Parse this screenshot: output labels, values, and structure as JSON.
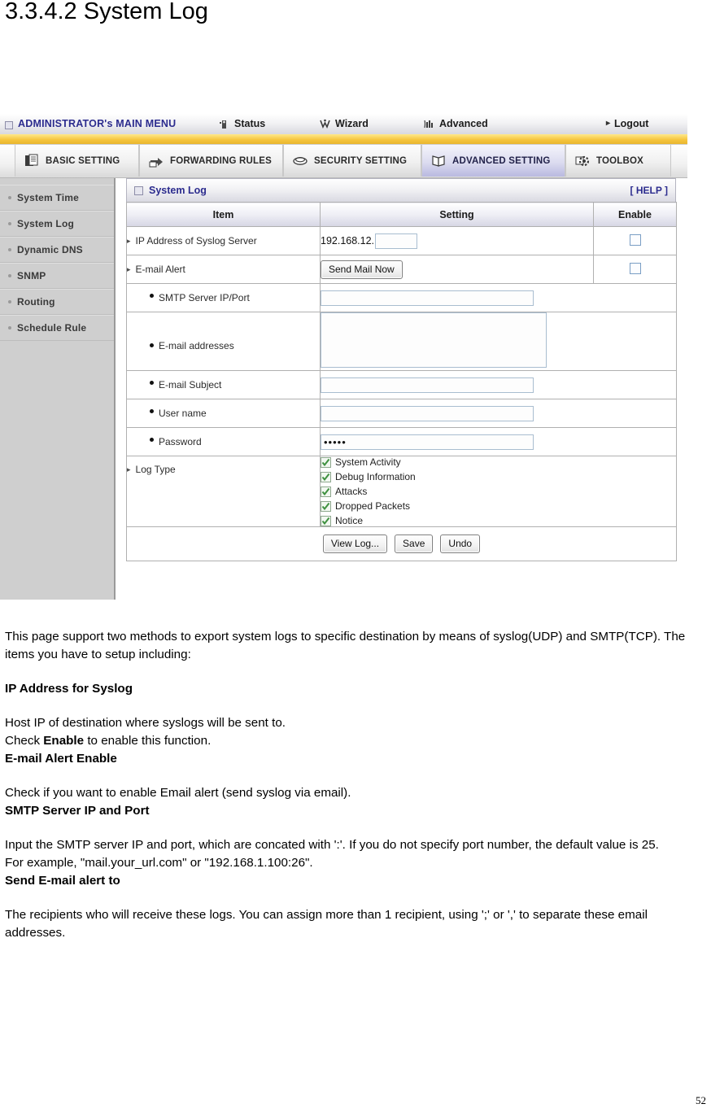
{
  "doc": {
    "heading": "3.3.4.2 System Log",
    "page_number": "52"
  },
  "router_ui": {
    "topbar": {
      "admin_menu": "ADMINISTRATOR's MAIN MENU",
      "status": "Status",
      "wizard": "Wizard",
      "advanced": "Advanced",
      "logout": "Logout"
    },
    "tabs": [
      {
        "label": "BASIC SETTING",
        "icon": "documents-icon",
        "active": false
      },
      {
        "label": "FORWARDING RULES",
        "icon": "forward-arrow-icon",
        "active": false
      },
      {
        "label": "SECURITY SETTING",
        "icon": "shield-icon",
        "active": false
      },
      {
        "label": "ADVANCED SETTING",
        "icon": "book-icon",
        "active": true
      },
      {
        "label": "TOOLBOX",
        "icon": "gear-icon",
        "active": false
      }
    ],
    "sidebar": {
      "items": [
        {
          "label": "System Time"
        },
        {
          "label": "System Log"
        },
        {
          "label": "Dynamic DNS"
        },
        {
          "label": "SNMP"
        },
        {
          "label": "Routing"
        },
        {
          "label": "Schedule Rule"
        }
      ]
    },
    "panel": {
      "title": "System Log",
      "help": "[ HELP ]",
      "columns": {
        "item": "Item",
        "setting": "Setting",
        "enable": "Enable"
      },
      "rows": {
        "syslog_ip": {
          "label": "IP Address of Syslog Server",
          "ip_prefix": "192.168.12.",
          "octet_value": "",
          "enable_checked": false
        },
        "email_alert": {
          "label": "E-mail Alert",
          "button": "Send Mail Now",
          "enable_checked": false
        },
        "smtp_server": {
          "label": "SMTP Server IP/Port",
          "value": ""
        },
        "email_addresses": {
          "label": "E-mail addresses",
          "value": ""
        },
        "email_subject": {
          "label": "E-mail Subject",
          "value": ""
        },
        "user_name": {
          "label": "User name",
          "value": ""
        },
        "password": {
          "label": "Password",
          "value": "•••••"
        },
        "log_type": {
          "label": "Log Type",
          "options": [
            {
              "label": "System Activity",
              "checked": true
            },
            {
              "label": "Debug Information",
              "checked": true
            },
            {
              "label": "Attacks",
              "checked": true
            },
            {
              "label": "Dropped Packets",
              "checked": true
            },
            {
              "label": "Notice",
              "checked": true
            }
          ]
        }
      },
      "footer_buttons": {
        "view_log": "View Log...",
        "save": "Save",
        "undo": "Undo"
      }
    },
    "colors": {
      "accent_blue": "#2c2c8e",
      "band_yellow": "#f6c63f",
      "active_tab": "#b9b9e0",
      "sidebar_gray": "#cfcfcf",
      "check_green": "#3f9140"
    }
  },
  "prose": {
    "intro": "This page support two methods to export system logs to specific destination by means of syslog(UDP) and SMTP(TCP). The items you have to setup including:",
    "h_ip_syslog": "IP Address for Syslog",
    "p_host_ip_1": "Host IP of destination where syslogs will be sent to.",
    "p_check_pre": "Check ",
    "p_check_bold": "Enable",
    "p_check_post": " to enable this function.",
    "h_email_alert": "E-mail Alert Enable",
    "p_email_alert": "Check if you want to enable Email alert (send syslog via email).",
    "h_smtp": "SMTP Server IP and Port",
    "p_smtp_1": "Input the SMTP server IP and port, which are concated with ':'. If you do not specify port number, the default value is 25.",
    "p_smtp_2": "For example, \"mail.your_url.com\" or \"192.168.1.100:26\".",
    "h_send_email": "Send E-mail alert to",
    "p_recipients": "The recipients who will receive these logs. You can assign more than 1 recipient, using ';' or ',' to separate these email addresses."
  }
}
